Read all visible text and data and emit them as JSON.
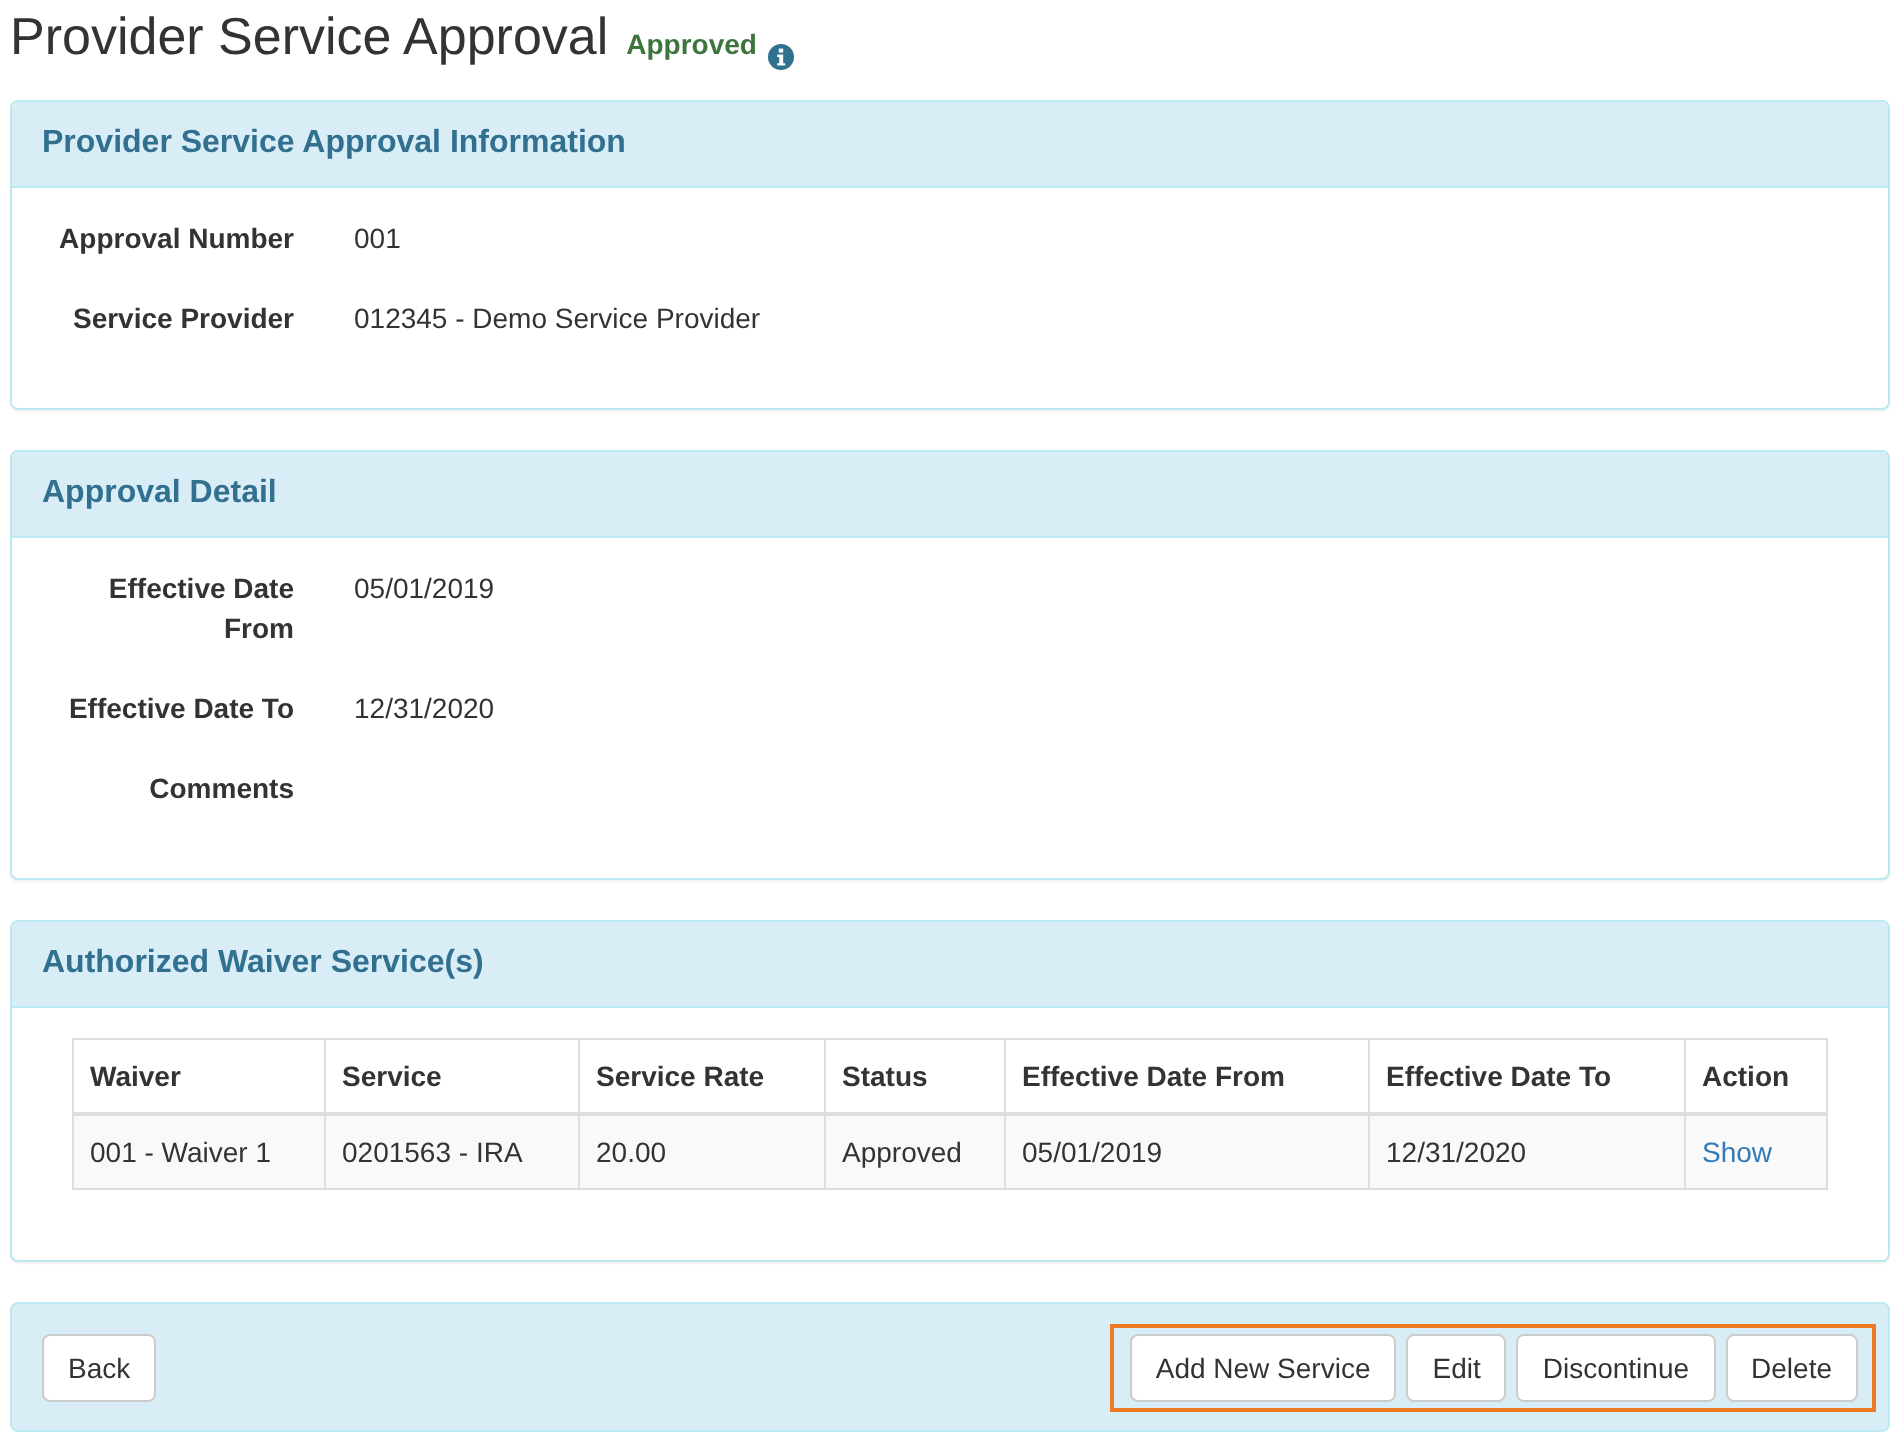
{
  "page": {
    "title": "Provider Service Approval",
    "status": "Approved"
  },
  "panels": [
    {
      "kind": "details",
      "title": "Provider Service Approval Information",
      "fields": [
        {
          "label": "Approval Number",
          "value": "001"
        },
        {
          "label": "Service Provider",
          "value": "012345 - Demo Service Provider"
        }
      ]
    },
    {
      "kind": "details",
      "title": "Approval Detail",
      "fields": [
        {
          "label": "Effective Date From",
          "value": "05/01/2019"
        },
        {
          "label": "Effective Date To",
          "value": "12/31/2020"
        },
        {
          "label": "Comments"
        }
      ]
    },
    {
      "kind": "table",
      "title": "Authorized Waiver Service(s)",
      "table": {
        "columns": [
          "Waiver",
          "Service",
          "Service Rate",
          "Status",
          "Effective Date From",
          "Effective Date To",
          "Action"
        ],
        "rows": [
          {
            "cells": [
              "001 - Waiver 1",
              "0201563 - IRA",
              "20.00",
              "Approved",
              "05/01/2019",
              "12/31/2020"
            ],
            "action": "Show"
          }
        ]
      }
    }
  ],
  "footer": {
    "back_button": "Back",
    "actions_highlighted": true,
    "actions": [
      "Add New Service",
      "Edit",
      "Discontinue",
      "Delete"
    ]
  }
}
